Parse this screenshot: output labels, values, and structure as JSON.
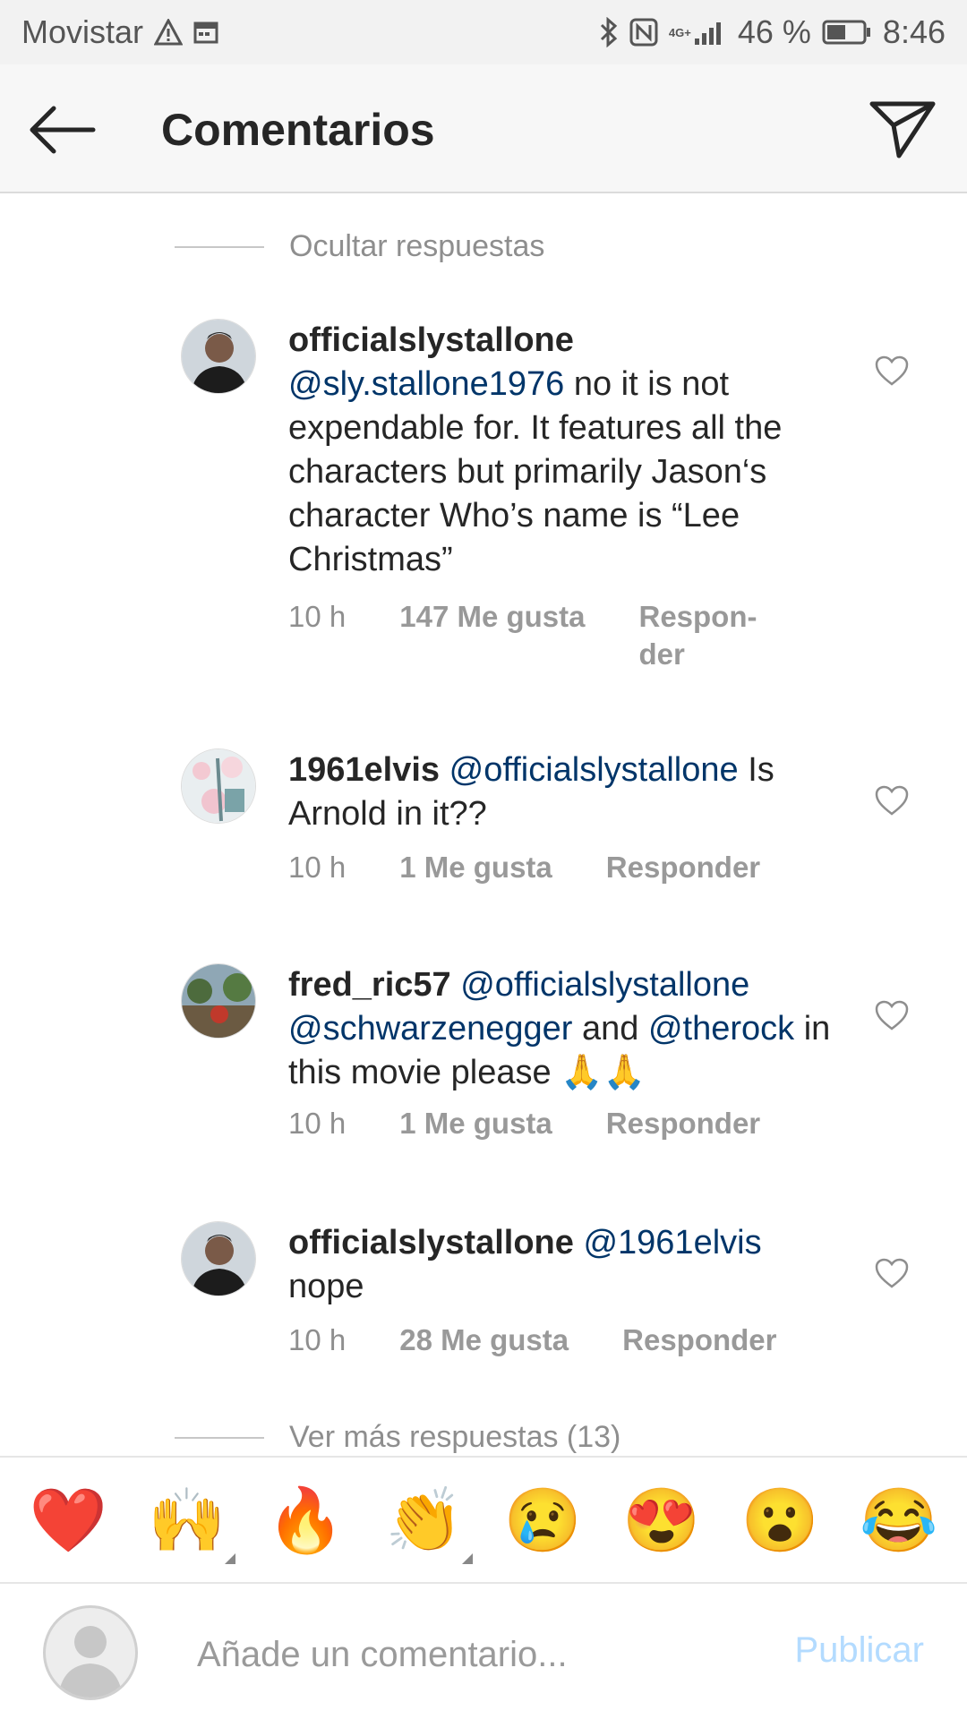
{
  "status_bar": {
    "carrier": "Movistar",
    "network_label": "4G+",
    "battery": "46 %",
    "time": "8:46"
  },
  "header": {
    "title": "Comentarios"
  },
  "replies": {
    "hide_label": "Ocultar respuestas",
    "more_label": "Ver más respuestas (13)"
  },
  "comments": [
    {
      "username": "officialslystallone",
      "mention": "@sly.stallone1976",
      "text": " no it is not expendable for. It features all the characters but primarily Jason‘s character Who’s name is “Lee Christmas”",
      "time": "10 h",
      "likes": "147 Me gusta",
      "reply": "Respon-der"
    },
    {
      "username": "1961elvis",
      "mention": "@officialslystallone",
      "text": " Is Arnold in it??",
      "time": "10 h",
      "likes": "1 Me gusta",
      "reply": "Responder"
    },
    {
      "username": "fred_ric57",
      "mention": "@officialslystallone",
      "mention2": "@schwarzenegger",
      "text_mid": " and ",
      "mention3": "@therock",
      "text": " in this movie please 🙏🙏",
      "time": "10 h",
      "likes": "1 Me gusta",
      "reply": "Responder"
    },
    {
      "username": "officialslystallone",
      "mention": "@1961elvis",
      "text": " nope",
      "time": "10 h",
      "likes": "28 Me gusta",
      "reply": "Responder"
    }
  ],
  "emoji_bar": [
    "❤️",
    "🙌",
    "🔥",
    "👏",
    "😢",
    "😍",
    "😮",
    "😂"
  ],
  "input": {
    "placeholder": "Añade un comentario...",
    "value": "",
    "publish_label": "Publicar"
  },
  "colors": {
    "mention": "#003569",
    "meta": "#8e8e8e",
    "publish_disabled": "#b3dbff"
  }
}
